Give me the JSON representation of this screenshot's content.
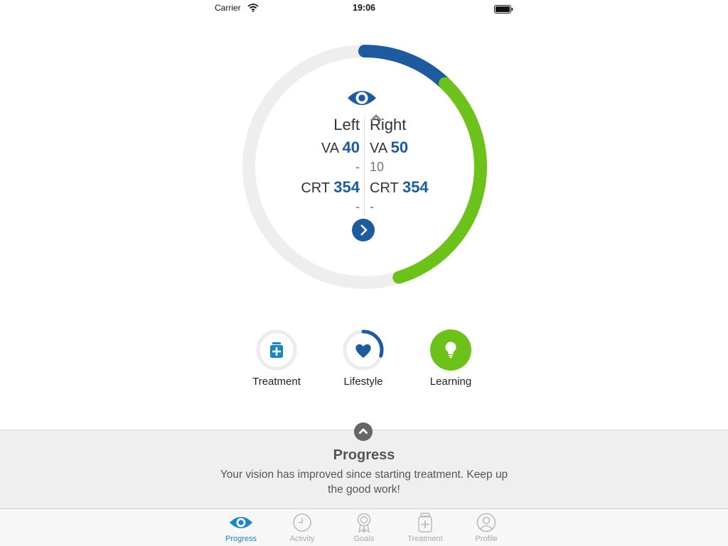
{
  "status_bar": {
    "carrier": "Carrier",
    "time": "19:06"
  },
  "progress_ring": {
    "blue_fraction": 0.12,
    "green_fraction": 0.33,
    "colors": {
      "track": "#eeeeee",
      "blue": "#1d5a9e",
      "green": "#6cc21b"
    }
  },
  "eyes": {
    "left": {
      "name": "Left",
      "va_label": "VA",
      "va_value": "40",
      "va_delta": "-",
      "crt_label": "CRT",
      "crt_value": "354",
      "crt_delta": "-"
    },
    "right": {
      "name": "Right",
      "va_label": "VA",
      "va_value": "50",
      "va_delta": "10",
      "crt_label": "CRT",
      "crt_value": "354",
      "crt_delta": "-"
    }
  },
  "categories": [
    {
      "label": "Treatment",
      "icon": "medicine-bottle-icon",
      "progress": 0
    },
    {
      "label": "Lifestyle",
      "icon": "heart-icon",
      "progress": 0.3
    },
    {
      "label": "Learning",
      "icon": "lightbulb-icon",
      "progress": 1
    }
  ],
  "summary": {
    "title": "Progress",
    "text": "Your vision has improved since starting treatment. Keep up the good work!"
  },
  "tabs": [
    {
      "label": "Progress",
      "icon": "eye-icon",
      "active": true
    },
    {
      "label": "Activity",
      "icon": "clock-icon",
      "active": false
    },
    {
      "label": "Goals",
      "icon": "award-icon",
      "active": false
    },
    {
      "label": "Treatment",
      "icon": "medicine-bottle-icon",
      "active": false
    },
    {
      "label": "Profile",
      "icon": "profile-icon",
      "active": false
    }
  ]
}
